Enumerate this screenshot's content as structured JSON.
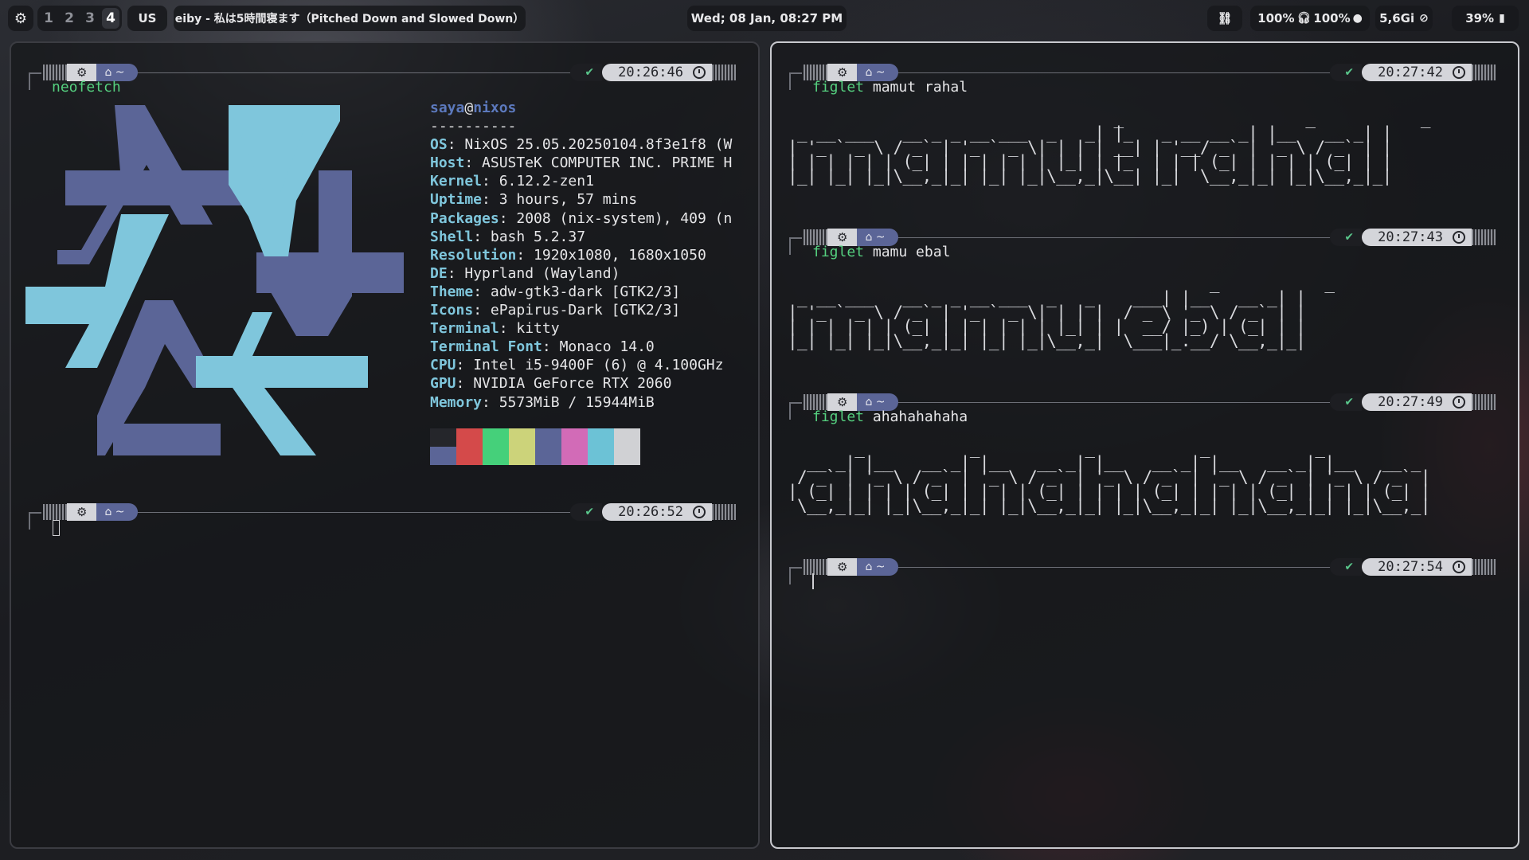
{
  "topbar": {
    "settings_icon": "gear-icon",
    "workspaces": [
      "1",
      "2",
      "3",
      "4"
    ],
    "active_workspace": "4",
    "keyboard_layout": "US",
    "window_title": "eiby - 私は5時間寝ます（Pitched Down and Slowed Down）",
    "datetime": "Wed; 08 Jan, 08:27 PM",
    "link_icon": "link-icon",
    "volume": "100%",
    "headphones_icon": "headphones-icon",
    "mic": "100%",
    "mic_icon": "microphone-icon",
    "memory": "5,6Gi",
    "memory_icon": "memory-icon",
    "battery": "39%",
    "battery_icon": "battery-icon"
  },
  "colors": {
    "accent_blue": "#5b6597",
    "cyan": "#7fc6dc",
    "green": "#55d07f",
    "nix_dark": "#5b6597",
    "nix_light": "#7fc6dc"
  },
  "left_terminal": {
    "prompts": [
      {
        "dir": "~",
        "time": "20:26:46",
        "command": "neofetch"
      },
      {
        "dir": "~",
        "time": "20:26:52",
        "command": ""
      }
    ],
    "neofetch": {
      "user": "saya",
      "at": "@",
      "host": "nixos",
      "separator": "----------",
      "fields": [
        {
          "key": "OS",
          "value": ": NixOS 25.05.20250104.8f3e1f8 (W"
        },
        {
          "key": "Host",
          "value": ": ASUSTeK COMPUTER INC. PRIME H"
        },
        {
          "key": "Kernel",
          "value": ": 6.12.2-zen1"
        },
        {
          "key": "Uptime",
          "value": ": 3 hours, 57 mins"
        },
        {
          "key": "Packages",
          "value": ": 2008 (nix-system), 409 (n"
        },
        {
          "key": "Shell",
          "value": ": bash 5.2.37"
        },
        {
          "key": "Resolution",
          "value": ": 1920x1080, 1680x1050"
        },
        {
          "key": "DE",
          "value": ": Hyprland (Wayland)"
        },
        {
          "key": "Theme",
          "value": ": adw-gtk3-dark [GTK2/3]"
        },
        {
          "key": "Icons",
          "value": ": ePapirus-Dark [GTK2/3]"
        },
        {
          "key": "Terminal",
          "value": ": kitty"
        },
        {
          "key": "Terminal Font",
          "value": ": Monaco 14.0"
        },
        {
          "key": "CPU",
          "value": ": Intel i5-9400F (6) @ 4.100GHz"
        },
        {
          "key": "GPU",
          "value": ": NVIDIA GeForce RTX 2060"
        },
        {
          "key": "Memory",
          "value": ": 5573MiB / 15944MiB"
        }
      ],
      "palette_top": [
        "#25262b",
        "#d44a4a",
        "#45d07a",
        "#ccd37a",
        "#5b6597",
        "#d26bb7",
        "#6cc2d6",
        "#d0d1d4"
      ],
      "palette_bottom": [
        "#5b6597",
        "#d44a4a",
        "#45d07a",
        "#ccd37a",
        "#5b6597",
        "#d26bb7",
        "#6cc2d6",
        "#d0d1d4"
      ]
    }
  },
  "right_terminal": {
    "prompts": [
      {
        "dir": "~",
        "time": "20:27:42",
        "command_name": "figlet",
        "args": " mamut rahal"
      },
      {
        "dir": "~",
        "time": "20:27:43",
        "command_name": "figlet",
        "args": " mamu ebal"
      },
      {
        "dir": "~",
        "time": "20:27:49",
        "command_name": "figlet",
        "args": " ahahahahaha"
      },
      {
        "dir": "~",
        "time": "20:27:54",
        "command_name": "",
        "args": ""
      }
    ],
    "figlet_outputs": [
      "                                  _                   _           _ \n _ __ ___   __ _ _ __ ___  _   _| |_   _ __ __ _| |__   __ _| |\n| '_ ` _ \\ / _` | '_ ` _ \\| | | | __| | '__/ _` | '_ \\ / _` | |\n| | | | | | (_| | | | | | | |_| | |_  | | | (_| | | | | (_| | |\n|_| |_| |_|\\__,_|_| |_| |_|\\__,_|\\__| |_|  \\__,_|_| |_|\\__,_|_|",
      "                                            _           _ \n _ __ ___   __ _ _ __ ___  _   _    ___| |__   __ _| |\n| '_ ` _ \\ / _` | '_ ` _ \\| | | |  / _ \\ '_ \\ / _` | |\n| | | | | | (_| | | | | | | |_| | |  __/ |_) | (_| | |\n|_| |_| |_|\\__,_|_| |_| |_|\\__,_|  \\___|_.__/ \\__,_|_|",
      "       _           _           _           _           _          \n  __ _| |__   __ _| |__   __ _| |__   __ _| |__   __ _| |__   __ _ \n / _` | '_ \\ / _` | '_ \\ / _` | '_ \\ / _` | '_ \\ / _` | '_ \\ / _` |\n| (_| | | | | (_| | | | | (_| | | | | (_| | | | | (_| | | | | (_| |\n \\__,_|_| |_|\\__,_|_| |_|\\__,_|_| |_|\\__,_|_| |_|\\__,_|_| |_|\\__,_|"
    ]
  }
}
